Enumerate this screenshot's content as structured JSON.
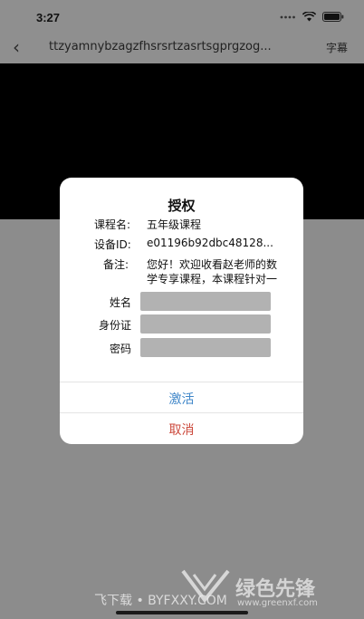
{
  "status": {
    "time": "3:27"
  },
  "nav": {
    "title": "ttzyamnybzagzfhsrsrtzasrtsgprgzog...",
    "right_label": "字幕"
  },
  "dialog": {
    "title": "授权",
    "course_label": "课程名:",
    "course_value": "五年级课程",
    "device_label": "设备ID:",
    "device_value": "e01196b92dbc48128...",
    "note_label": "备注:",
    "note_text": "您好！欢迎收看赵老师的数学专享课程，本课程针对一年级学",
    "name_label": "姓名",
    "id_label": "身份证",
    "password_label": "密码",
    "activate_label": "激活",
    "cancel_label": "取消"
  },
  "watermark": {
    "left_text": "飞下载 • BYFXXY.COM",
    "brand": "绿色先锋",
    "url": "www.greenxf.com"
  }
}
